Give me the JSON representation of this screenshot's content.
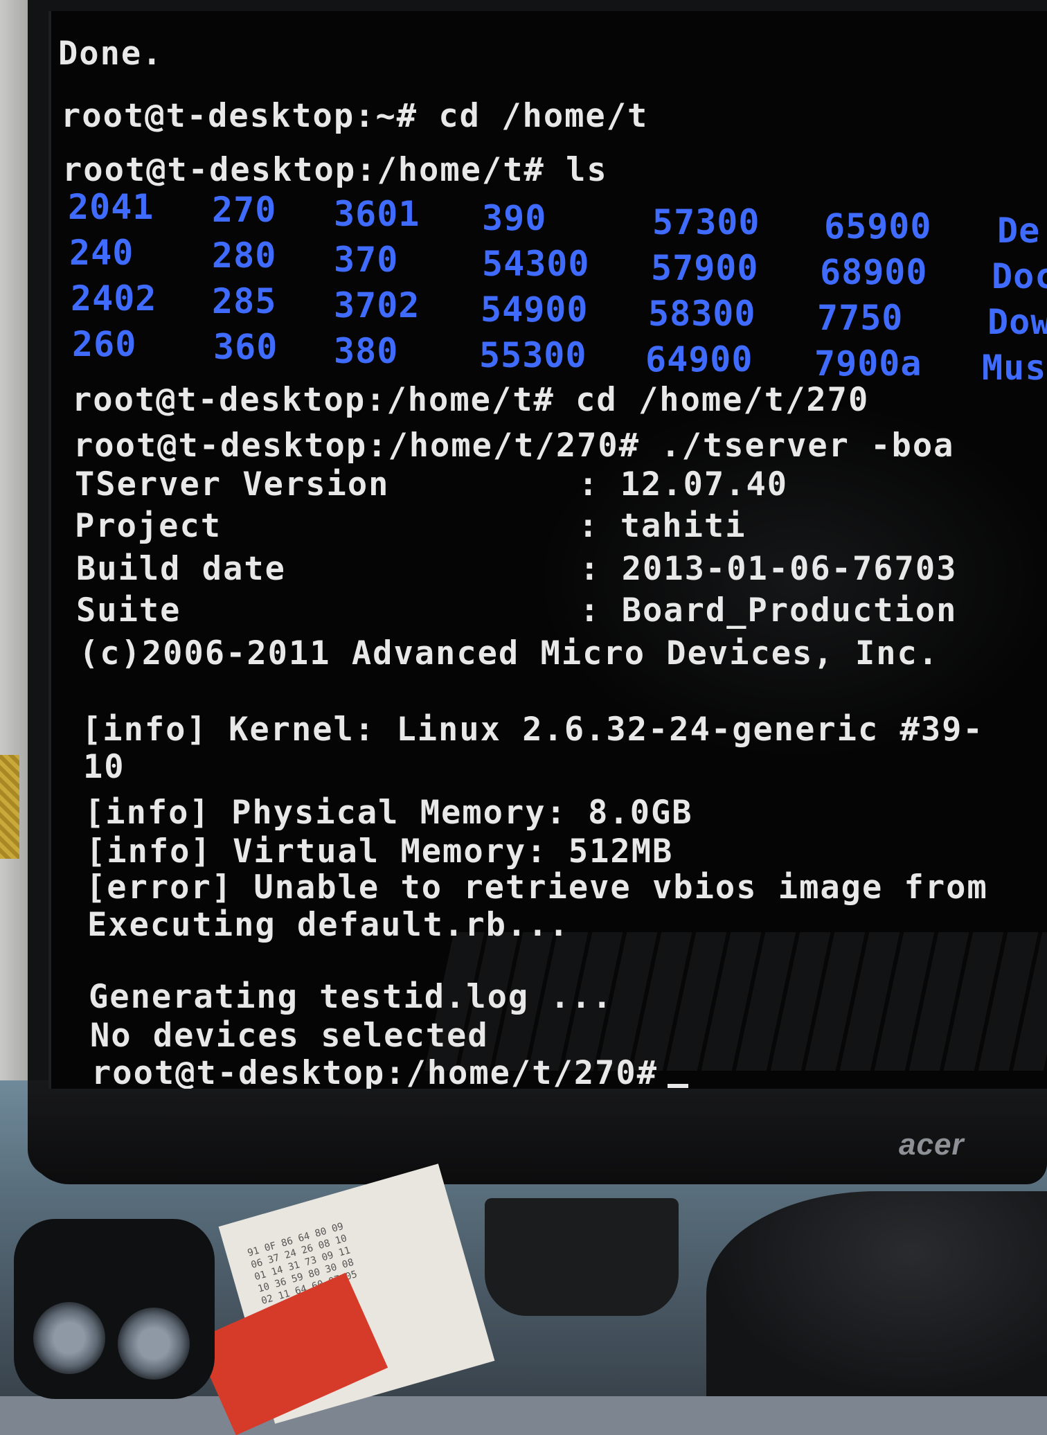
{
  "terminal": {
    "lines": [
      {
        "text": "Done."
      },
      {
        "text": "root@t-desktop:~# cd /home/t"
      },
      {
        "text": "root@t-desktop:/home/t# ls"
      },
      {
        "text": "root@t-desktop:/home/t# cd /home/t/270"
      },
      {
        "text": "root@t-desktop:/home/t/270# ./tserver -boa"
      },
      {
        "text": "TServer Version         : 12.07.40"
      },
      {
        "text": "Project                 : tahiti"
      },
      {
        "text": "Build date              : 2013-01-06-76703"
      },
      {
        "text": "Suite                   : Board_Production"
      },
      {
        "text": "(c)2006-2011 Advanced Micro Devices, Inc."
      },
      {
        "text": "[info] Kernel: Linux 2.6.32-24-generic #39-"
      },
      {
        "text": "10"
      },
      {
        "text": "[info] Physical Memory: 8.0GB"
      },
      {
        "text": "[info] Virtual Memory: 512MB"
      },
      {
        "text": "[error] Unable to retrieve vbios image from"
      },
      {
        "text": "Executing default.rb..."
      },
      {
        "text": "Generating testid.log ..."
      },
      {
        "text": "No devices selected"
      },
      {
        "text": "root@t-desktop:/home/t/270#"
      }
    ],
    "ls_output": [
      [
        "2041",
        "270",
        "3601",
        "390",
        "57300",
        "65900",
        "De"
      ],
      [
        "240",
        "280",
        "370",
        "54300",
        "57900",
        "68900",
        "Doc"
      ],
      [
        "2402",
        "285",
        "3702",
        "54900",
        "58300",
        "7750",
        "Dow"
      ],
      [
        "260",
        "360",
        "380",
        "55300",
        "64900",
        "7900a",
        "Mus"
      ]
    ],
    "text_color": "#e8e8e8",
    "directory_color": "#3f6cff",
    "background": "#050505"
  },
  "monitor": {
    "brand": "acer"
  },
  "receipt_lines": "91 0F 86 64 80 09\n06 37 24 26 08 10\n01 14 31 73 09 11\n10 36 59 80 30 08\n02 11 64 60 07 05"
}
